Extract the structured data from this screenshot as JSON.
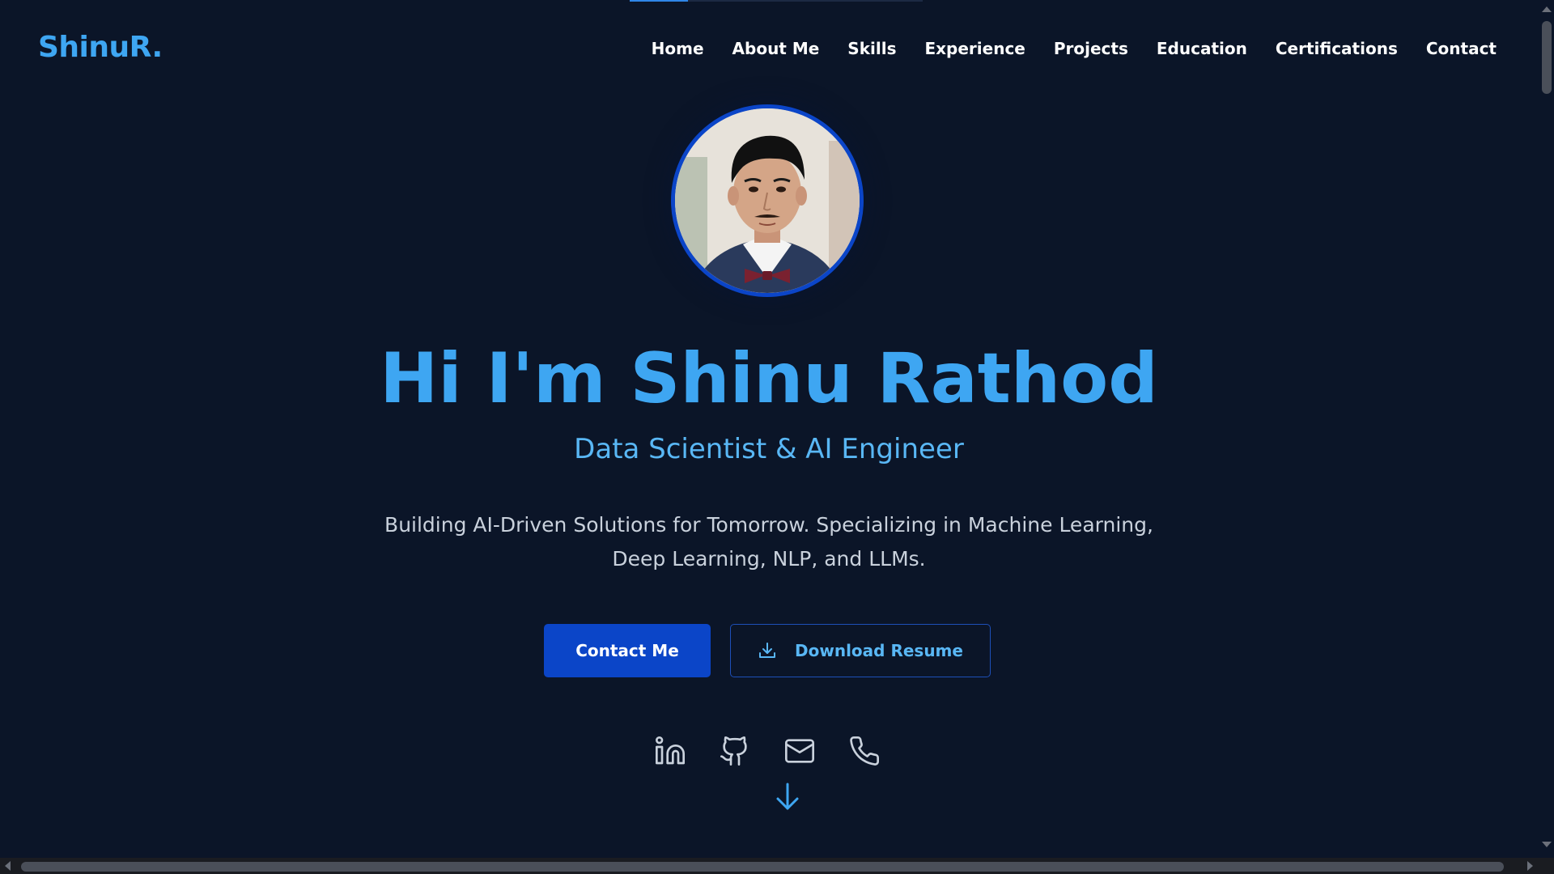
{
  "progress": {
    "fraction": 0.2,
    "color": "#2f86e8"
  },
  "brand": {
    "logo_text": "ShinuR.",
    "accent_color": "#3ea6f2",
    "primary_button_color": "#0b45c8",
    "background_color": "#0b1528"
  },
  "nav": {
    "items": [
      {
        "label": "Home"
      },
      {
        "label": "About Me"
      },
      {
        "label": "Skills"
      },
      {
        "label": "Experience"
      },
      {
        "label": "Projects"
      },
      {
        "label": "Education"
      },
      {
        "label": "Certifications"
      },
      {
        "label": "Contact"
      }
    ]
  },
  "hero": {
    "avatar_icon": "profile-photo",
    "title": "Hi I'm Shinu Rathod",
    "subtitle": "Data Scientist & AI Engineer",
    "description": "Building AI-Driven Solutions for Tomorrow. Specializing in Machine Learning, Deep Learning, NLP, and LLMs.",
    "contact_button": "Contact Me",
    "resume_button": "Download Resume",
    "resume_icon": "download-icon"
  },
  "socials": [
    {
      "icon": "linkedin-icon"
    },
    {
      "icon": "github-icon"
    },
    {
      "icon": "mail-icon"
    },
    {
      "icon": "phone-icon"
    }
  ],
  "scroll_indicator": {
    "icon": "arrow-down-icon"
  }
}
